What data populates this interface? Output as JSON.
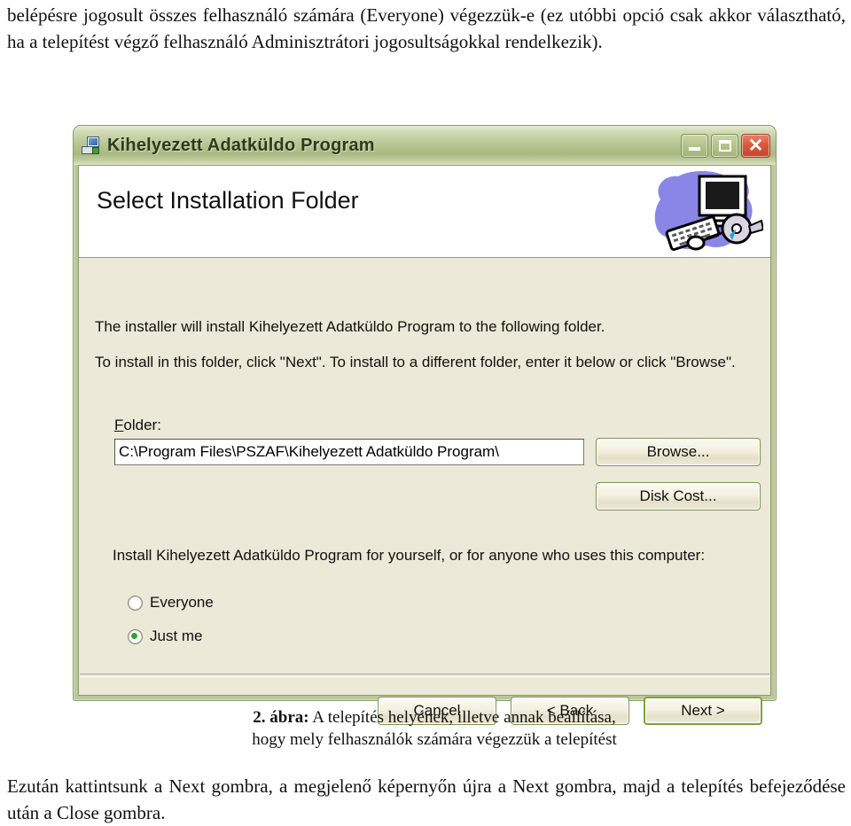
{
  "document": {
    "intro_paragraph": "belépésre jogosult összes felhasználó számára (Everyone) végezzük-e (ez utóbbi opció csak akkor választható, ha a telepítést végző felhasználó Adminisztrátori jogosultságokkal rendelkezik).",
    "figure_caption_label": "2. ábra:",
    "figure_caption_line1": " A telepítés helyének, illetve annak beállítása,",
    "figure_caption_line2": "hogy mely felhasználók számára végezzük a telepítést",
    "closing_paragraph": "Ezután kattintsunk a Next gombra, a megjelenő képernyőn újra a Next gombra, majd a telepítés befejeződése után a Close gombra."
  },
  "installer": {
    "window": {
      "title": "Kihelyezett Adatküldo Program",
      "icon": "installer-package-icon",
      "caption_buttons": {
        "minimize": "minimize-icon",
        "maximize": "maximize-icon",
        "close": "✕"
      }
    },
    "banner": {
      "title": "Select Installation Folder",
      "artwork": "computer-setup-illustration"
    },
    "body": {
      "line1": "The installer will install Kihelyezett Adatküldo Program to the following folder.",
      "line2": "To install in this folder, click \"Next\". To install to a different folder, enter it below or click \"Browse\".",
      "folder_label_accel": "F",
      "folder_label_rest": "older:",
      "folder_path": "C:\\Program Files\\PSZAF\\Kihelyezett Adatküldo Program\\",
      "folder_path_placeholder": "C:\\Program Files\\",
      "browse_button": "Browse...",
      "disk_cost_button": "Disk Cost...",
      "scope_question": "Install Kihelyezett Adatküldo Program for yourself, or for anyone who uses this computer:",
      "scope_options": [
        {
          "label": "Everyone",
          "selected": false
        },
        {
          "label": "Just me",
          "selected": true
        }
      ]
    },
    "footer": {
      "cancel_button": "Cancel",
      "back_button": "< Back",
      "next_button": "Next >"
    },
    "colors": {
      "title_bar": "#b8c894",
      "client_background": "#ece9d8",
      "banner_background": "#ffffff",
      "close_button": "#d9573a",
      "default_button_border": "#7ba23f",
      "radio_selected_dot": "#2fa12f"
    }
  }
}
